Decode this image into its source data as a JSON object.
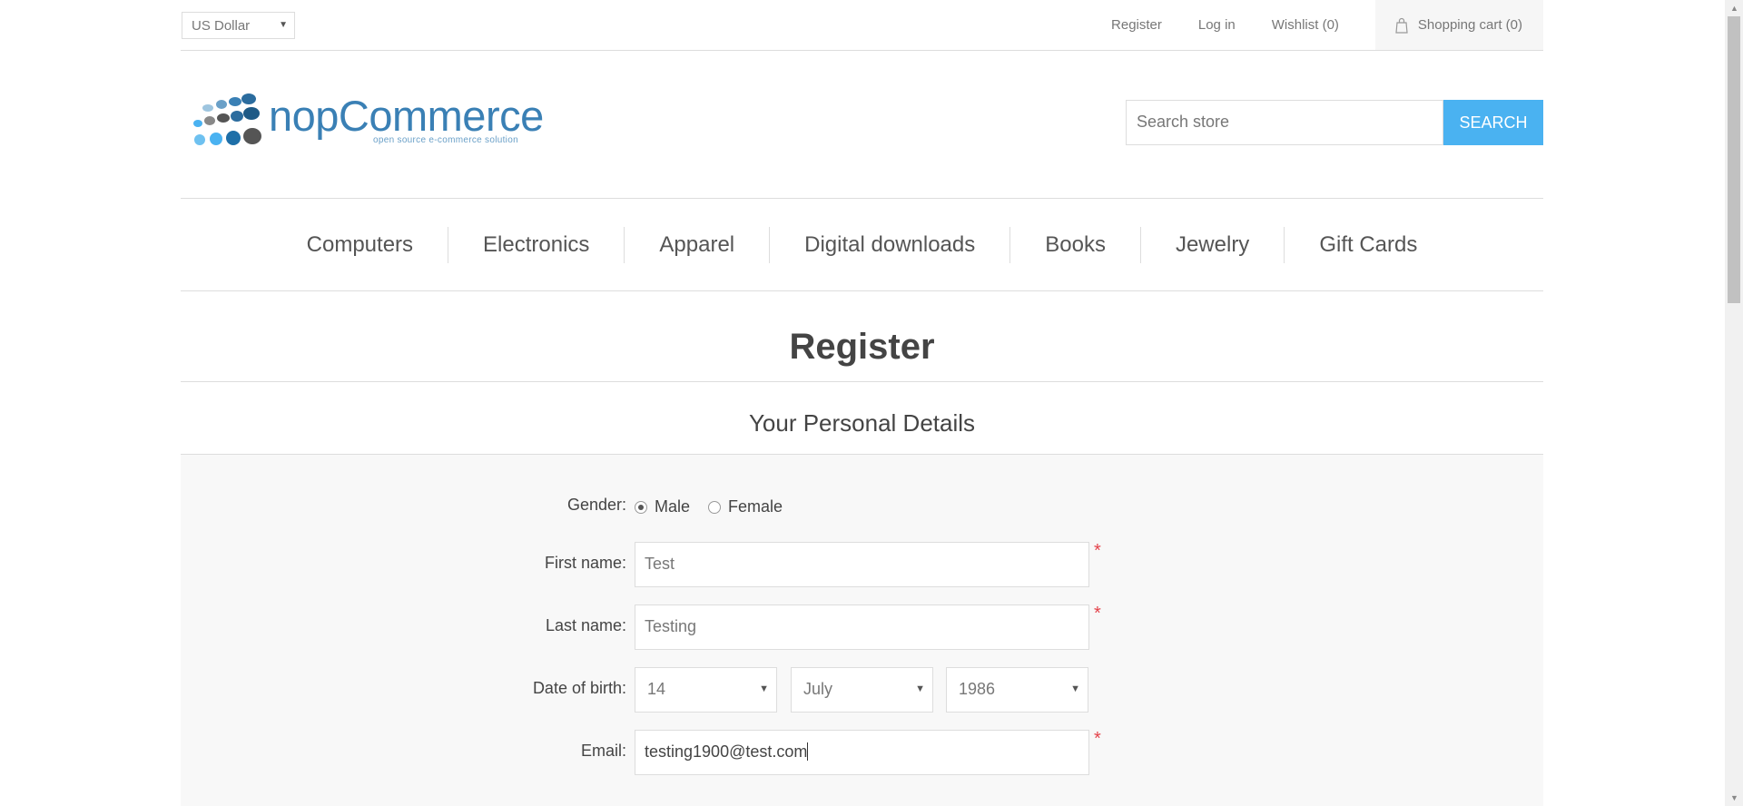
{
  "header": {
    "currency": "US Dollar",
    "links": [
      "Register",
      "Log in",
      "Wishlist (0)"
    ],
    "cart_label": "Shopping cart (0)",
    "cart_icon": "shopping-bag-icon"
  },
  "logo": {
    "name": "nopCommerce",
    "tagline": "open source e-commerce solution"
  },
  "search": {
    "placeholder": "Search store",
    "button_label": "SEARCH"
  },
  "menu": [
    "Computers",
    "Electronics",
    "Apparel",
    "Digital downloads",
    "Books",
    "Jewelry",
    "Gift Cards"
  ],
  "page": {
    "title": "Register",
    "section_title": "Your Personal Details"
  },
  "form": {
    "gender_label": "Gender:",
    "gender_options": [
      "Male",
      "Female"
    ],
    "gender_selected": "Male",
    "first_name_label": "First name:",
    "first_name_value": "Test",
    "last_name_label": "Last name:",
    "last_name_value": "Testing",
    "dob_label": "Date of birth:",
    "dob_day": "14",
    "dob_month": "July",
    "dob_year": "1986",
    "email_label": "Email:",
    "email_value": "testing1900@test.com",
    "required_mark": "*"
  },
  "colors": {
    "accent": "#4ab2f1",
    "required": "#e4434b",
    "logo_blue": "#3a80b5"
  }
}
